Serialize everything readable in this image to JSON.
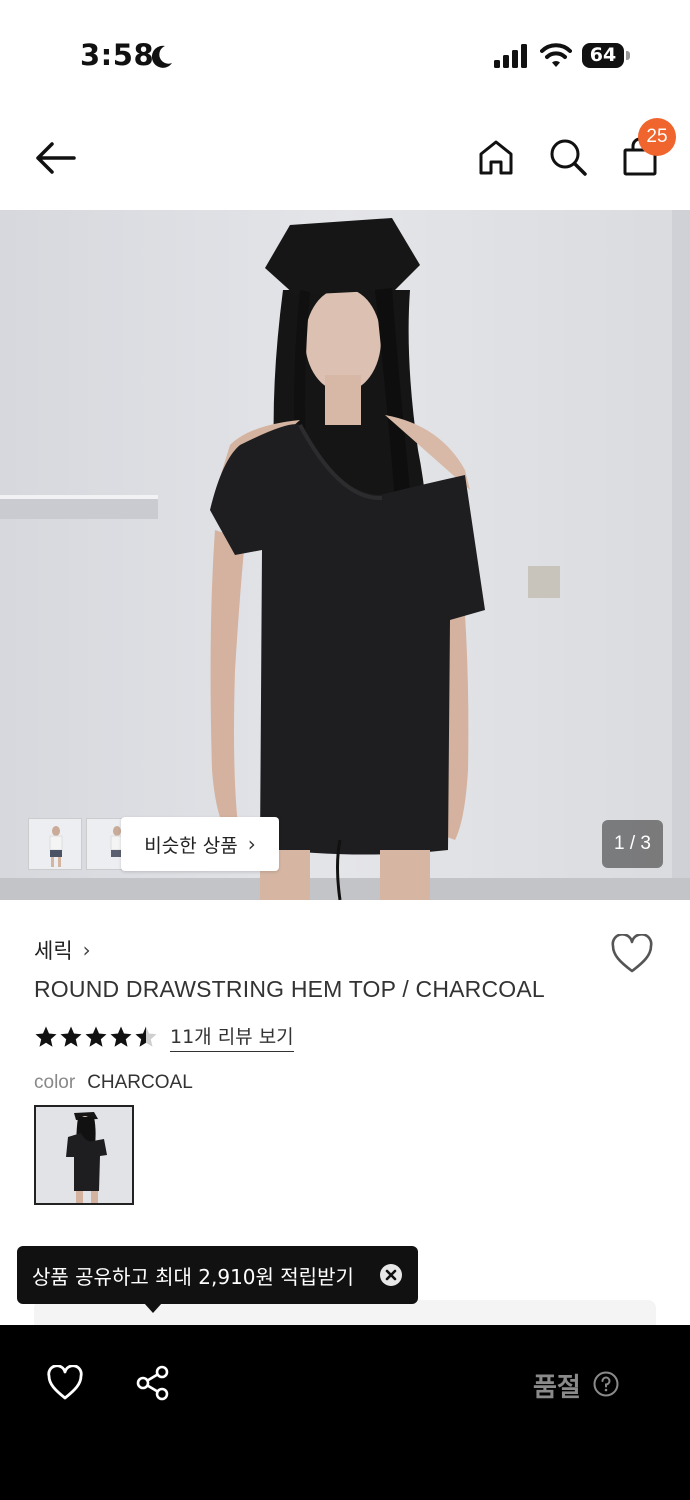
{
  "status_bar": {
    "time": "3:58",
    "battery": "64"
  },
  "nav": {
    "cart_count": "25"
  },
  "gallery": {
    "similar_label": "비슷한 상품",
    "page_counter": "1 / 3"
  },
  "product": {
    "brand": "세릭",
    "title": "ROUND DRAWSTRING HEM TOP / CHARCOAL",
    "rating": 4.5,
    "review_link": "11개 리뷰 보기",
    "color_label": "color",
    "color_value": "CHARCOAL"
  },
  "tooltip": {
    "text": "상품 공유하고 최대 2,910원 적립받기"
  },
  "bottom_bar": {
    "status_label": "품절"
  },
  "colors": {
    "accent": "#f0642d",
    "bar": "#000000",
    "muted": "#8a8a8a"
  }
}
